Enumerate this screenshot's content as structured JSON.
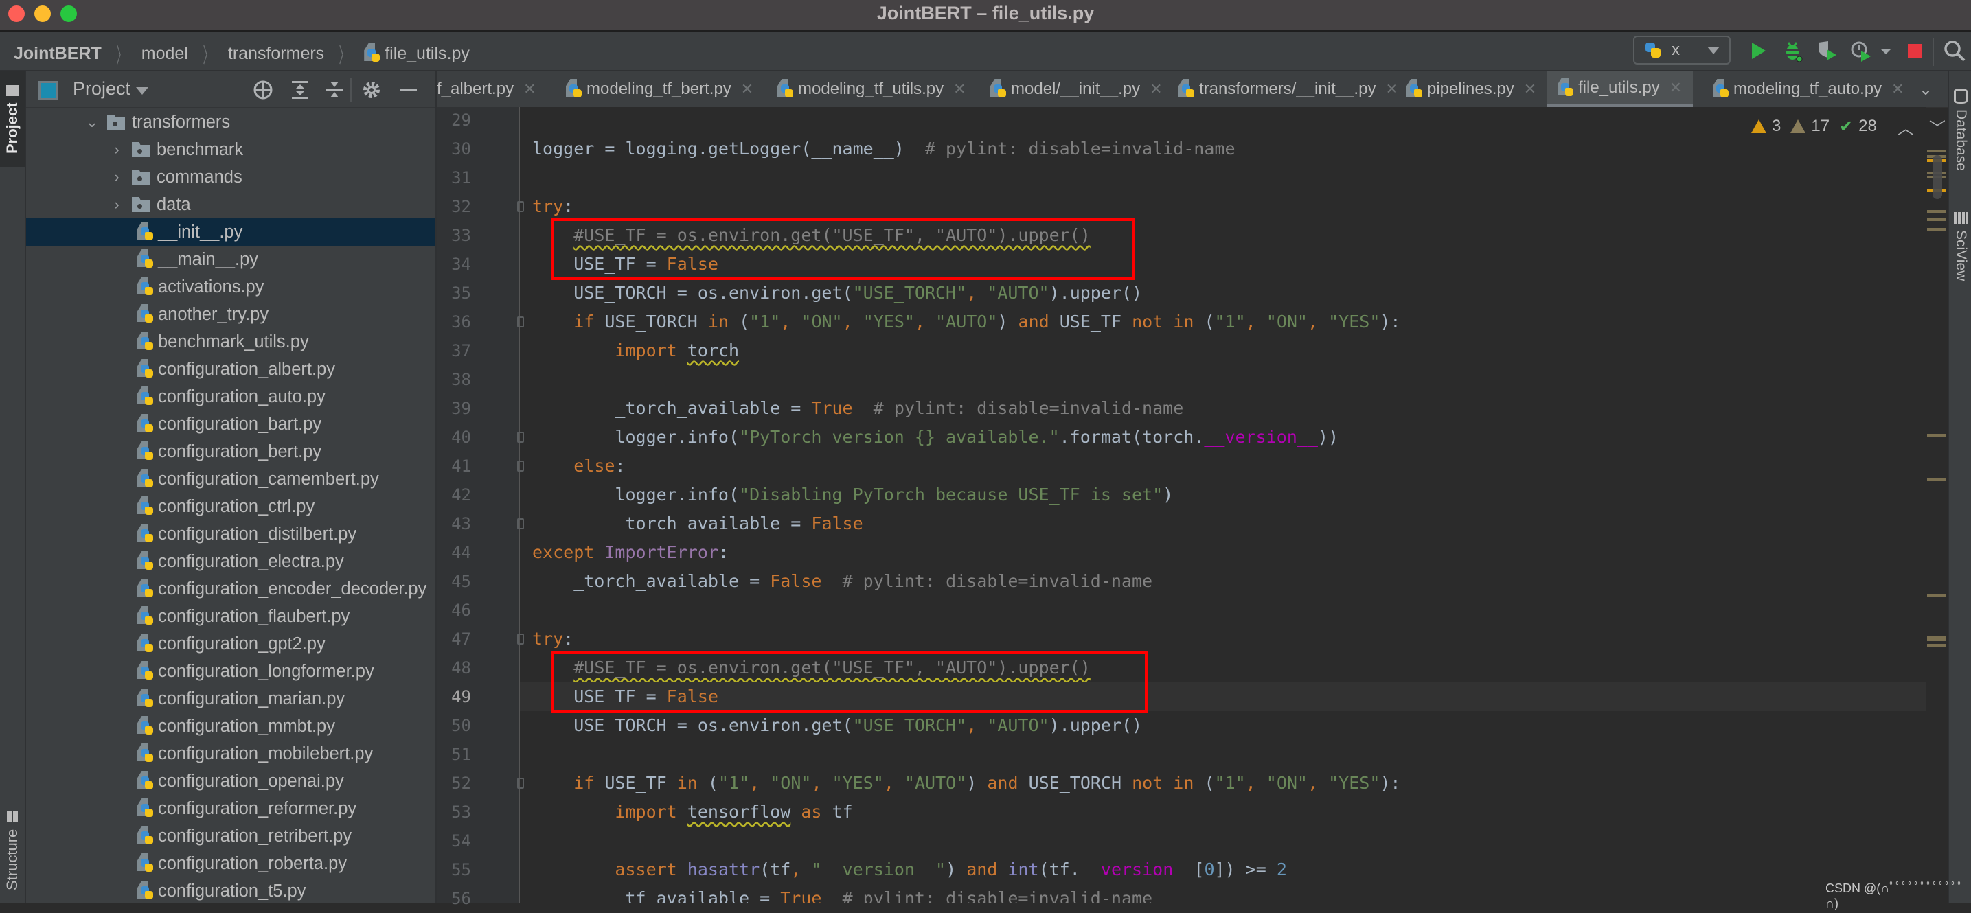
{
  "window": {
    "title": "JointBERT – file_utils.py",
    "traffic_lights": {
      "close": "#fe5f57",
      "minimize": "#febc2e",
      "zoom": "#28c840"
    }
  },
  "navbar": {
    "breadcrumbs": [
      "JointBERT",
      "model",
      "transformers",
      "file_utils.py"
    ],
    "run_config": {
      "name": "x",
      "icon": "python-icon"
    },
    "toolbar_icons": [
      "run-icon",
      "debug-icon",
      "coverage-icon",
      "profile-icon",
      "more-dropdown-icon",
      "stop-icon",
      "search-icon"
    ]
  },
  "left_stripe": {
    "tabs": [
      "Project",
      "Structure"
    ]
  },
  "right_stripe": {
    "tabs": [
      "Database",
      "SciView"
    ]
  },
  "project_panel": {
    "title": "Project",
    "header_icons": [
      "locate-icon",
      "expand-all-icon",
      "collapse-all-icon",
      "gear-icon",
      "hide-icon"
    ],
    "tree": [
      {
        "name": "transformers",
        "type": "folder",
        "expanded": true,
        "depth": 0
      },
      {
        "name": "benchmark",
        "type": "folder",
        "expanded": false,
        "depth": 1
      },
      {
        "name": "commands",
        "type": "folder",
        "expanded": false,
        "depth": 1
      },
      {
        "name": "data",
        "type": "folder",
        "expanded": false,
        "depth": 1
      },
      {
        "name": "__init__.py",
        "type": "file",
        "depth": 1,
        "selected": true
      },
      {
        "name": "__main__.py",
        "type": "file",
        "depth": 1
      },
      {
        "name": "activations.py",
        "type": "file",
        "depth": 1
      },
      {
        "name": "another_try.py",
        "type": "file",
        "depth": 1
      },
      {
        "name": "benchmark_utils.py",
        "type": "file",
        "depth": 1
      },
      {
        "name": "configuration_albert.py",
        "type": "file",
        "depth": 1
      },
      {
        "name": "configuration_auto.py",
        "type": "file",
        "depth": 1
      },
      {
        "name": "configuration_bart.py",
        "type": "file",
        "depth": 1
      },
      {
        "name": "configuration_bert.py",
        "type": "file",
        "depth": 1
      },
      {
        "name": "configuration_camembert.py",
        "type": "file",
        "depth": 1
      },
      {
        "name": "configuration_ctrl.py",
        "type": "file",
        "depth": 1
      },
      {
        "name": "configuration_distilbert.py",
        "type": "file",
        "depth": 1
      },
      {
        "name": "configuration_electra.py",
        "type": "file",
        "depth": 1
      },
      {
        "name": "configuration_encoder_decoder.py",
        "type": "file",
        "depth": 1
      },
      {
        "name": "configuration_flaubert.py",
        "type": "file",
        "depth": 1
      },
      {
        "name": "configuration_gpt2.py",
        "type": "file",
        "depth": 1
      },
      {
        "name": "configuration_longformer.py",
        "type": "file",
        "depth": 1
      },
      {
        "name": "configuration_marian.py",
        "type": "file",
        "depth": 1
      },
      {
        "name": "configuration_mmbt.py",
        "type": "file",
        "depth": 1
      },
      {
        "name": "configuration_mobilebert.py",
        "type": "file",
        "depth": 1
      },
      {
        "name": "configuration_openai.py",
        "type": "file",
        "depth": 1
      },
      {
        "name": "configuration_reformer.py",
        "type": "file",
        "depth": 1
      },
      {
        "name": "configuration_retribert.py",
        "type": "file",
        "depth": 1
      },
      {
        "name": "configuration_roberta.py",
        "type": "file",
        "depth": 1
      },
      {
        "name": "configuration_t5.py",
        "type": "file",
        "depth": 1
      }
    ]
  },
  "tabs": [
    {
      "label": "f_albert.py",
      "active": false
    },
    {
      "label": "modeling_tf_bert.py",
      "active": false
    },
    {
      "label": "modeling_tf_utils.py",
      "active": false
    },
    {
      "label": "model/__init__.py",
      "active": false
    },
    {
      "label": "transformers/__init__.py",
      "active": false
    },
    {
      "label": "pipelines.py",
      "active": false
    },
    {
      "label": "file_utils.py",
      "active": true
    },
    {
      "label": "modeling_tf_auto.py",
      "active": false
    }
  ],
  "inspections": {
    "warnings": "3",
    "weak_warnings": "17",
    "ok": "28"
  },
  "editor": {
    "current_line": 49,
    "lines": [
      {
        "n": 29,
        "tokens": []
      },
      {
        "n": 30,
        "tokens": [
          [
            "",
            "logger = logging.getLogger(__name__)  "
          ],
          [
            "cmt",
            "# pylint: disable=invalid-name"
          ]
        ]
      },
      {
        "n": 31,
        "tokens": []
      },
      {
        "n": 32,
        "tokens": [
          [
            "kw",
            "try"
          ],
          [
            "",
            ":"
          ]
        ]
      },
      {
        "n": 33,
        "tokens": [
          [
            "",
            "    "
          ],
          [
            "cmt squiggle",
            "#USE_TF = os.environ.get(\"USE_TF\", \"AUTO\").upper()"
          ]
        ]
      },
      {
        "n": 34,
        "tokens": [
          [
            "",
            "    USE_TF = "
          ],
          [
            "kw",
            "False"
          ]
        ]
      },
      {
        "n": 35,
        "tokens": [
          [
            "",
            "    USE_TORCH = os.environ.get("
          ],
          [
            "str",
            "\"USE_TORCH\""
          ],
          [
            "kw",
            ", "
          ],
          [
            "str",
            "\"AUTO\""
          ],
          [
            "",
            ").upper()"
          ]
        ]
      },
      {
        "n": 36,
        "tokens": [
          [
            "",
            "    "
          ],
          [
            "kw",
            "if"
          ],
          [
            "",
            " USE_TORCH "
          ],
          [
            "kw",
            "in"
          ],
          [
            "",
            " ("
          ],
          [
            "str",
            "\"1\""
          ],
          [
            "kw",
            ", "
          ],
          [
            "str",
            "\"ON\""
          ],
          [
            "kw",
            ", "
          ],
          [
            "str",
            "\"YES\""
          ],
          [
            "kw",
            ", "
          ],
          [
            "str",
            "\"AUTO\""
          ],
          [
            "",
            ") "
          ],
          [
            "kw",
            "and"
          ],
          [
            "",
            " USE_TF "
          ],
          [
            "kw",
            "not in"
          ],
          [
            "",
            " ("
          ],
          [
            "str",
            "\"1\""
          ],
          [
            "kw",
            ", "
          ],
          [
            "str",
            "\"ON\""
          ],
          [
            "kw",
            ", "
          ],
          [
            "str",
            "\"YES\""
          ],
          [
            "",
            "):"
          ]
        ]
      },
      {
        "n": 37,
        "tokens": [
          [
            "",
            "        "
          ],
          [
            "kw",
            "import"
          ],
          [
            "",
            " "
          ],
          [
            "squiggle",
            "torch"
          ]
        ]
      },
      {
        "n": 38,
        "tokens": []
      },
      {
        "n": 39,
        "tokens": [
          [
            "",
            "        _torch_available = "
          ],
          [
            "kw",
            "True"
          ],
          [
            "",
            "  "
          ],
          [
            "cmt",
            "# pylint: disable=invalid-name"
          ]
        ]
      },
      {
        "n": 40,
        "tokens": [
          [
            "",
            "        logger.info("
          ],
          [
            "str",
            "\"PyTorch version {} available.\""
          ],
          [
            "",
            ".format(torch."
          ],
          [
            "magic",
            "__version__"
          ],
          [
            "",
            "))"
          ]
        ]
      },
      {
        "n": 41,
        "tokens": [
          [
            "",
            "    "
          ],
          [
            "kw",
            "else"
          ],
          [
            "",
            ":"
          ]
        ]
      },
      {
        "n": 42,
        "tokens": [
          [
            "",
            "        logger.info("
          ],
          [
            "str",
            "\"Disabling PyTorch because USE_TF is set\""
          ],
          [
            "",
            ")"
          ]
        ]
      },
      {
        "n": 43,
        "tokens": [
          [
            "",
            "        _torch_available = "
          ],
          [
            "kw",
            "False"
          ]
        ]
      },
      {
        "n": 44,
        "tokens": [
          [
            "kw",
            "except"
          ],
          [
            "",
            " "
          ],
          [
            "cls",
            "ImportError"
          ],
          [
            "",
            ":"
          ]
        ]
      },
      {
        "n": 45,
        "tokens": [
          [
            "",
            "    _torch_available = "
          ],
          [
            "kw",
            "False"
          ],
          [
            "",
            "  "
          ],
          [
            "cmt",
            "# pylint: disable=invalid-name"
          ]
        ]
      },
      {
        "n": 46,
        "tokens": []
      },
      {
        "n": 47,
        "tokens": [
          [
            "kw",
            "try"
          ],
          [
            "",
            ":"
          ]
        ]
      },
      {
        "n": 48,
        "tokens": [
          [
            "",
            "    "
          ],
          [
            "cmt squiggle",
            "#USE_TF = os.environ.get(\"USE_TF\", \"AUTO\").upper()"
          ]
        ]
      },
      {
        "n": 49,
        "tokens": [
          [
            "",
            "    USE_TF = "
          ],
          [
            "kw",
            "False"
          ]
        ]
      },
      {
        "n": 50,
        "tokens": [
          [
            "",
            "    USE_TORCH = os.environ.get("
          ],
          [
            "str",
            "\"USE_TORCH\""
          ],
          [
            "kw",
            ", "
          ],
          [
            "str",
            "\"AUTO\""
          ],
          [
            "",
            ").upper()"
          ]
        ]
      },
      {
        "n": 51,
        "tokens": []
      },
      {
        "n": 52,
        "tokens": [
          [
            "",
            "    "
          ],
          [
            "kw",
            "if"
          ],
          [
            "",
            " USE_TF "
          ],
          [
            "kw",
            "in"
          ],
          [
            "",
            " ("
          ],
          [
            "str",
            "\"1\""
          ],
          [
            "kw",
            ", "
          ],
          [
            "str",
            "\"ON\""
          ],
          [
            "kw",
            ", "
          ],
          [
            "str",
            "\"YES\""
          ],
          [
            "kw",
            ", "
          ],
          [
            "str",
            "\"AUTO\""
          ],
          [
            "",
            ") "
          ],
          [
            "kw",
            "and"
          ],
          [
            "",
            " USE_TORCH "
          ],
          [
            "kw",
            "not in"
          ],
          [
            "",
            " ("
          ],
          [
            "str",
            "\"1\""
          ],
          [
            "kw",
            ", "
          ],
          [
            "str",
            "\"ON\""
          ],
          [
            "kw",
            ", "
          ],
          [
            "str",
            "\"YES\""
          ],
          [
            "",
            "):"
          ]
        ]
      },
      {
        "n": 53,
        "tokens": [
          [
            "",
            "        "
          ],
          [
            "kw",
            "import"
          ],
          [
            "",
            " "
          ],
          [
            "squiggle",
            "tensorflow"
          ],
          [
            "",
            " "
          ],
          [
            "kw",
            "as"
          ],
          [
            "",
            " tf"
          ]
        ]
      },
      {
        "n": 54,
        "tokens": []
      },
      {
        "n": 55,
        "tokens": [
          [
            "",
            "        "
          ],
          [
            "kw",
            "assert"
          ],
          [
            "",
            " "
          ],
          [
            "builtin",
            "hasattr"
          ],
          [
            "",
            "(tf"
          ],
          [
            "kw",
            ", "
          ],
          [
            "str",
            "\"__version__\""
          ],
          [
            "",
            ") "
          ],
          [
            "kw",
            "and"
          ],
          [
            "",
            " "
          ],
          [
            "builtin",
            "int"
          ],
          [
            "",
            "(tf."
          ],
          [
            "magic",
            "__version__"
          ],
          [
            "",
            "["
          ],
          [
            "num",
            "0"
          ],
          [
            "",
            "]) >= "
          ],
          [
            "num",
            "2"
          ]
        ]
      },
      {
        "n": 56,
        "tokens": [
          [
            "",
            "        _tf_available = "
          ],
          [
            "kw",
            "True"
          ],
          [
            "",
            "  "
          ],
          [
            "cmt",
            "# pylint: disable=invalid-name"
          ]
        ]
      }
    ],
    "highlight_boxes": [
      {
        "from_line": 33,
        "to_line": 34
      },
      {
        "from_line": 48,
        "to_line": 49
      }
    ],
    "fold_markers": [
      32,
      36,
      40,
      41,
      43,
      47,
      52
    ]
  },
  "watermark": "CSDN @(∩ﾟﾟﾟﾟﾟﾟﾟﾟﾟﾟﾟﾟ∩)"
}
